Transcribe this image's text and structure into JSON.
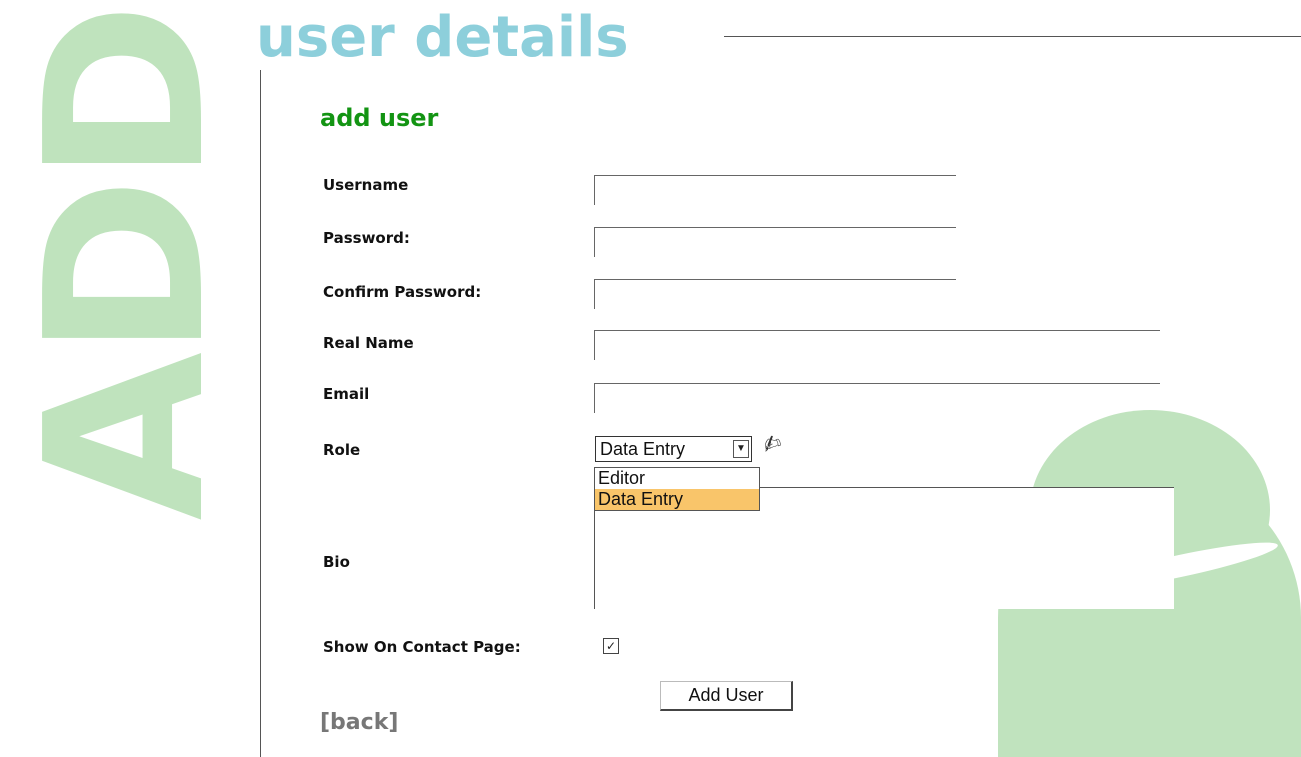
{
  "watermark": {
    "text": "ADD"
  },
  "header": {
    "title": "user details"
  },
  "form": {
    "title": "add user",
    "fields": {
      "username": {
        "label": "Username",
        "value": ""
      },
      "password": {
        "label": "Password:",
        "value": ""
      },
      "confirm_password": {
        "label": "Confirm Password:",
        "value": ""
      },
      "real_name": {
        "label": "Real Name",
        "value": ""
      },
      "email": {
        "label": "Email",
        "value": ""
      },
      "role": {
        "label": "Role",
        "selected": "Data Entry",
        "options": [
          "Editor",
          "Data Entry"
        ]
      },
      "bio": {
        "label": "Bio",
        "value": ""
      },
      "show_on_contact": {
        "label": "Show On Contact Page:",
        "checked": true
      }
    },
    "submit_label": "Add User",
    "back_label": "[back]"
  },
  "icons": {
    "role_icon": "role-edit-icon",
    "person": "user-silhouette"
  },
  "colors": {
    "title": "#8dcfdb",
    "section_title": "#139413",
    "watermark": "#bfe3bd",
    "highlight": "#f9c56a"
  }
}
